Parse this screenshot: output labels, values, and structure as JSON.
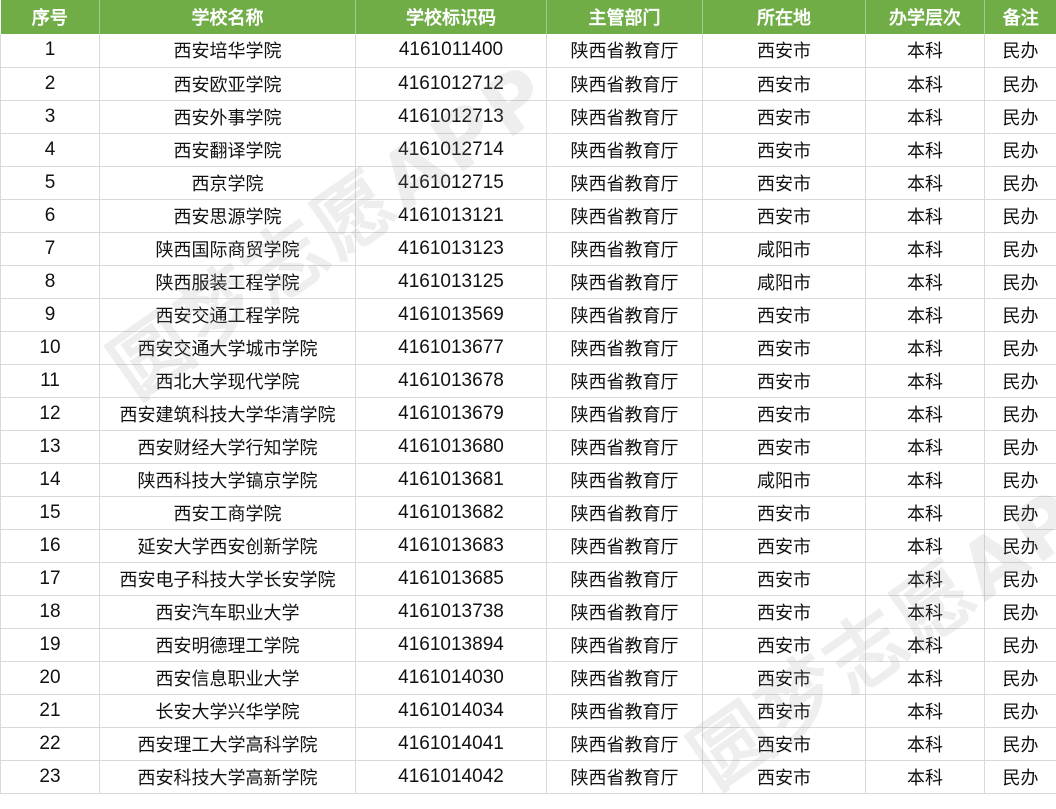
{
  "colors": {
    "header_bg": "#70ad47",
    "header_text": "#ffffff",
    "grid_line": "#d9d9d9"
  },
  "watermark": "圆梦志愿APP",
  "headers": [
    "序号",
    "学校名称",
    "学校标识码",
    "主管部门",
    "所在地",
    "办学层次",
    "备注"
  ],
  "rows": [
    [
      "1",
      "西安培华学院",
      "4161011400",
      "陕西省教育厅",
      "西安市",
      "本科",
      "民办"
    ],
    [
      "2",
      "西安欧亚学院",
      "4161012712",
      "陕西省教育厅",
      "西安市",
      "本科",
      "民办"
    ],
    [
      "3",
      "西安外事学院",
      "4161012713",
      "陕西省教育厅",
      "西安市",
      "本科",
      "民办"
    ],
    [
      "4",
      "西安翻译学院",
      "4161012714",
      "陕西省教育厅",
      "西安市",
      "本科",
      "民办"
    ],
    [
      "5",
      "西京学院",
      "4161012715",
      "陕西省教育厅",
      "西安市",
      "本科",
      "民办"
    ],
    [
      "6",
      "西安思源学院",
      "4161013121",
      "陕西省教育厅",
      "西安市",
      "本科",
      "民办"
    ],
    [
      "7",
      "陕西国际商贸学院",
      "4161013123",
      "陕西省教育厅",
      "咸阳市",
      "本科",
      "民办"
    ],
    [
      "8",
      "陕西服装工程学院",
      "4161013125",
      "陕西省教育厅",
      "咸阳市",
      "本科",
      "民办"
    ],
    [
      "9",
      "西安交通工程学院",
      "4161013569",
      "陕西省教育厅",
      "西安市",
      "本科",
      "民办"
    ],
    [
      "10",
      "西安交通大学城市学院",
      "4161013677",
      "陕西省教育厅",
      "西安市",
      "本科",
      "民办"
    ],
    [
      "11",
      "西北大学现代学院",
      "4161013678",
      "陕西省教育厅",
      "西安市",
      "本科",
      "民办"
    ],
    [
      "12",
      "西安建筑科技大学华清学院",
      "4161013679",
      "陕西省教育厅",
      "西安市",
      "本科",
      "民办"
    ],
    [
      "13",
      "西安财经大学行知学院",
      "4161013680",
      "陕西省教育厅",
      "西安市",
      "本科",
      "民办"
    ],
    [
      "14",
      "陕西科技大学镐京学院",
      "4161013681",
      "陕西省教育厅",
      "咸阳市",
      "本科",
      "民办"
    ],
    [
      "15",
      "西安工商学院",
      "4161013682",
      "陕西省教育厅",
      "西安市",
      "本科",
      "民办"
    ],
    [
      "16",
      "延安大学西安创新学院",
      "4161013683",
      "陕西省教育厅",
      "西安市",
      "本科",
      "民办"
    ],
    [
      "17",
      "西安电子科技大学长安学院",
      "4161013685",
      "陕西省教育厅",
      "西安市",
      "本科",
      "民办"
    ],
    [
      "18",
      "西安汽车职业大学",
      "4161013738",
      "陕西省教育厅",
      "西安市",
      "本科",
      "民办"
    ],
    [
      "19",
      "西安明德理工学院",
      "4161013894",
      "陕西省教育厅",
      "西安市",
      "本科",
      "民办"
    ],
    [
      "20",
      "西安信息职业大学",
      "4161014030",
      "陕西省教育厅",
      "西安市",
      "本科",
      "民办"
    ],
    [
      "21",
      "长安大学兴华学院",
      "4161014034",
      "陕西省教育厅",
      "西安市",
      "本科",
      "民办"
    ],
    [
      "22",
      "西安理工大学高科学院",
      "4161014041",
      "陕西省教育厅",
      "西安市",
      "本科",
      "民办"
    ],
    [
      "23",
      "西安科技大学高新学院",
      "4161014042",
      "陕西省教育厅",
      "西安市",
      "本科",
      "民办"
    ]
  ]
}
